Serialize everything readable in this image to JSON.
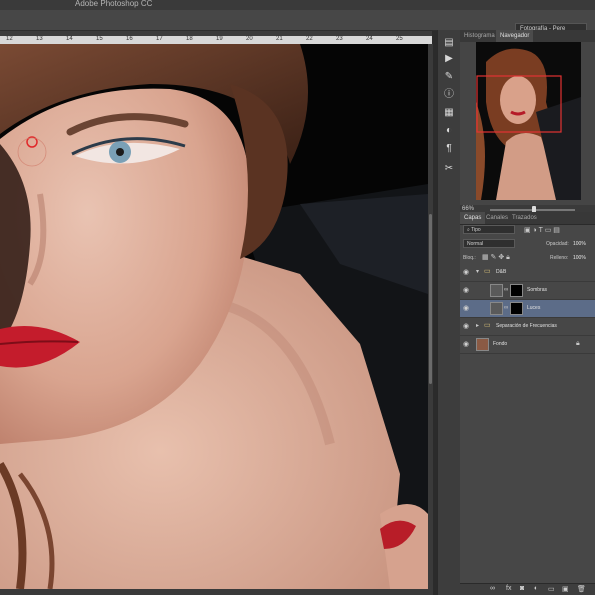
{
  "app": {
    "title": "Adobe Photoshop CC",
    "workspace": "Fotografía - Pere"
  },
  "ruler": {
    "ticks": [
      "12",
      "13",
      "14",
      "15",
      "16",
      "17",
      "18",
      "19",
      "20",
      "21",
      "22",
      "23",
      "24",
      "25"
    ]
  },
  "navigator": {
    "tabs": [
      "Histograma",
      "Navegador"
    ],
    "active_tab": "Navegador",
    "zoom": "66%"
  },
  "layers_panel": {
    "tabs": [
      "Capas",
      "Canales",
      "Trazados"
    ],
    "active_tab": "Capas",
    "filter": "Tipo",
    "blend_mode": "Normal",
    "opacity_label": "Opacidad:",
    "opacity_value": "100%",
    "lock_label": "Bloq.:",
    "fill_label": "Relleno:",
    "fill_value": "100%",
    "layers": [
      {
        "name": "D&B",
        "type": "group",
        "indent": 0
      },
      {
        "name": "Sombras",
        "type": "curves",
        "indent": 1
      },
      {
        "name": "Luces",
        "type": "curves",
        "indent": 1,
        "selected": true
      },
      {
        "name": "Separación de Frecuencias",
        "type": "group",
        "indent": 0
      },
      {
        "name": "Fondo",
        "type": "image",
        "indent": 0,
        "locked": true
      }
    ]
  },
  "colors": {
    "accent_selection": "#5c6c88",
    "nav_view_box": "#e33333",
    "brush_cursor": "#e0282a"
  },
  "icons": [
    "history-icon",
    "play-icon",
    "brush-preset-icon",
    "info-icon",
    "swatches-icon",
    "adjustments-icon",
    "paragraph-icon",
    "tools-icon"
  ]
}
